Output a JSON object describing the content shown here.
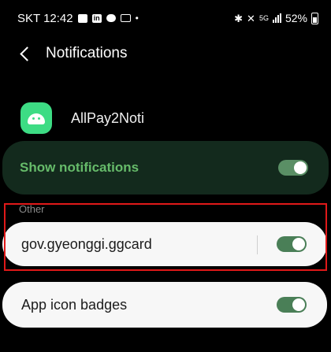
{
  "status": {
    "carrier_time": "SKT 12:42",
    "battery": "52%",
    "network_badge": "5G",
    "icons_left": [
      "message-icon",
      "linkedin-icon",
      "chat-icon",
      "card-icon",
      "dot-icon"
    ],
    "icons_right": [
      "bluetooth-icon",
      "mute-icon",
      "5g-icon",
      "signal-icon",
      "battery-icon"
    ]
  },
  "header": {
    "title": "Notifications",
    "back_icon": "back-arrow-icon"
  },
  "app": {
    "name": "AllPay2Noti",
    "icon": "android-app-icon"
  },
  "show_notifications": {
    "label": "Show notifications",
    "enabled": true
  },
  "categories": {
    "section_label": "Other",
    "items": [
      {
        "label": "gov.gyeonggi.ggcard",
        "enabled": true
      }
    ]
  },
  "badges": {
    "label": "App icon badges",
    "enabled": true
  },
  "colors": {
    "accent_green": "#66bb6a",
    "toggle_green": "#4a7f57",
    "highlight": "#e01919"
  }
}
